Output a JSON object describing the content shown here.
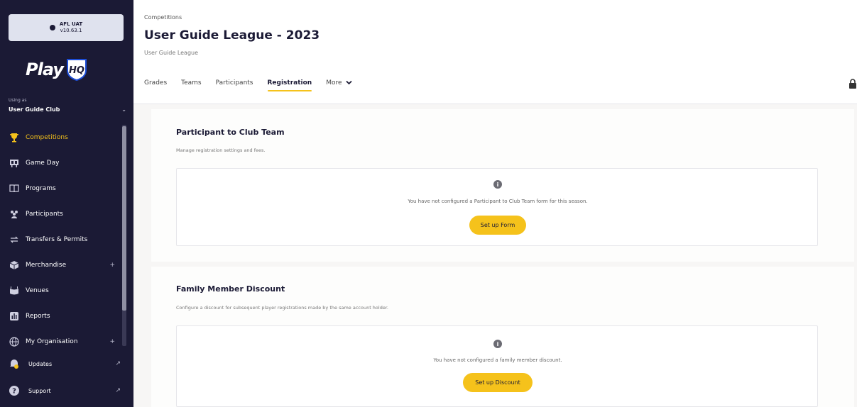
{
  "env": {
    "name": "AFL UAT",
    "version": "v10.63.1"
  },
  "logo": {
    "text": "Play",
    "mark": "HQ"
  },
  "account": {
    "using_as_label": "Using as",
    "club": "User Guide Club"
  },
  "nav": [
    {
      "label": "Competitions",
      "icon": "trophy-icon",
      "active": true
    },
    {
      "label": "Game Day",
      "icon": "scoreboard-icon"
    },
    {
      "label": "Programs",
      "icon": "book-icon"
    },
    {
      "label": "Participants",
      "icon": "people-icon"
    },
    {
      "label": "Transfers & Permits",
      "icon": "transfer-arrows-icon"
    },
    {
      "label": "Merchandise",
      "icon": "box-icon",
      "expand": "+"
    },
    {
      "label": "Venues",
      "icon": "stadium-icon"
    },
    {
      "label": "Reports",
      "icon": "chart-icon"
    },
    {
      "label": "My Organisation",
      "icon": "globe-icon",
      "expand": "+"
    }
  ],
  "bottom_nav": [
    {
      "label": "Updates",
      "icon": "bell-icon"
    },
    {
      "label": "Support",
      "icon": "question-icon"
    }
  ],
  "header": {
    "breadcrumb": "Competitions",
    "title": "User Guide League - 2023",
    "subtitle": "User Guide League"
  },
  "tabs": [
    {
      "label": "Grades"
    },
    {
      "label": "Teams"
    },
    {
      "label": "Participants"
    },
    {
      "label": "Registration",
      "active": true
    },
    {
      "label": "More"
    }
  ],
  "sections": [
    {
      "title": "Participant to Club Team",
      "description": "Manage registration settings and fees.",
      "message": "You have not configured a Participant to Club Team form for this season.",
      "button": "Set up Form"
    },
    {
      "title": "Family Member Discount",
      "description": "Configure a discount for subsequent player registrations made by the same account holder.",
      "message": "You have not configured a family member discount.",
      "button": "Set up Discount"
    }
  ],
  "colors": {
    "sidebar": "#1b1a35",
    "accent": "#f5c21b"
  }
}
